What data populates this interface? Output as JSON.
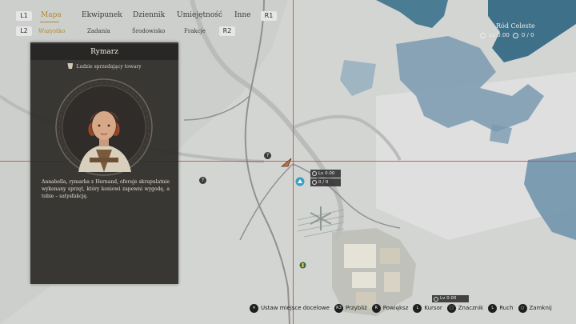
{
  "topbar": {
    "left_bumper": "L1",
    "right_bumper": "R1",
    "left_trigger": "L2",
    "right_trigger": "R2",
    "tabs": [
      {
        "label": "Mapa",
        "active": true
      },
      {
        "label": "Ekwipunek",
        "active": false
      },
      {
        "label": "Dziennik",
        "active": false
      },
      {
        "label": "Umiejętność",
        "active": false
      },
      {
        "label": "Inne",
        "active": false
      }
    ],
    "subtabs": [
      {
        "label": "Wszystko",
        "active": true
      },
      {
        "label": "Zadania",
        "active": false
      },
      {
        "label": "Środowisko",
        "active": false
      },
      {
        "label": "Frakcje",
        "active": false
      }
    ]
  },
  "region": {
    "name": "Ród Celeste",
    "level": "Lv 0.00",
    "count": "0 / 0"
  },
  "panel": {
    "title": "Rymarz",
    "subtitle": "Ludzie sprzedający towary",
    "description": "Annabella, rymarka z Hernand, oferuje skrupulatnie wykonany sprzęt, który koniowi zapewni wygodę, a tobie – satysfakcję."
  },
  "map_pills": {
    "level": "Lv 0.00",
    "count": "0 / 0",
    "bottom_level": "Lv 0.00"
  },
  "controls": [
    {
      "button": "✕",
      "label": "Ustaw miejsce docelowe"
    },
    {
      "button": "R3",
      "label": "Przybliż"
    },
    {
      "button": "R",
      "label": "Powiększ"
    },
    {
      "button": "L",
      "label": "Kursor"
    },
    {
      "button": "□",
      "label": "Znacznik"
    },
    {
      "button": "L",
      "label": "Ruch"
    },
    {
      "button": "○",
      "label": "Zamknij"
    }
  ],
  "colors": {
    "accent": "#b2892c",
    "crosshair": "#c84a3c",
    "water": "#6f93ad",
    "land": "#d4d6d4"
  }
}
